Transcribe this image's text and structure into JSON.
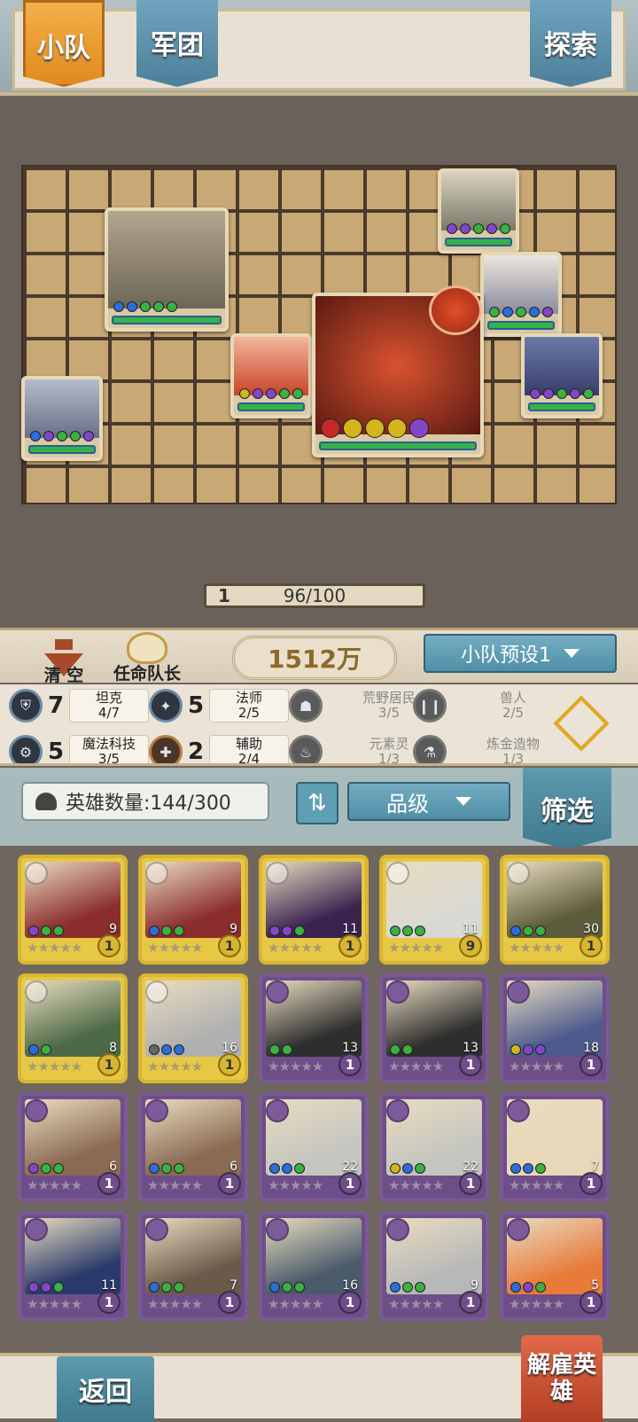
{
  "tabs": {
    "squad": "小队",
    "legion": "军团",
    "explore": "探索"
  },
  "squad": {
    "level": "1",
    "capacity": "96/100",
    "clear_label": "清 空",
    "captain_label": "任命队长",
    "power": "1512万",
    "preset": "小队预设1"
  },
  "synergies": [
    {
      "icon": "shield-icon",
      "count": "7",
      "name": "坦克",
      "progress": "4/7",
      "active": true
    },
    {
      "icon": "mage-icon",
      "count": "5",
      "name": "法师",
      "progress": "2/5",
      "active": true
    },
    {
      "icon": "wild-icon",
      "count": "",
      "name": "荒野居民",
      "progress": "3/5",
      "active": false
    },
    {
      "icon": "orc-icon",
      "count": "",
      "name": "兽人",
      "progress": "2/5",
      "active": false
    },
    {
      "icon": "tech-icon",
      "count": "5",
      "name": "魔法科技",
      "progress": "3/5",
      "active": true
    },
    {
      "icon": "support-icon",
      "count": "2",
      "name": "辅助",
      "progress": "2/4",
      "active": true
    },
    {
      "icon": "element-icon",
      "count": "",
      "name": "元素灵",
      "progress": "1/3",
      "active": false
    },
    {
      "icon": "alchemy-icon",
      "count": "",
      "name": "炼金造物",
      "progress": "1/3",
      "active": false
    }
  ],
  "filter": {
    "hero_count_label": "英雄数量:144/300",
    "sort_glyph": "⇅",
    "grade_label": "品级",
    "filter_label": "筛选"
  },
  "heroes": [
    {
      "count": "9",
      "level": "1",
      "tier": "gold",
      "dots": [
        "purple",
        "green",
        "green"
      ],
      "art": "#8b2d2d"
    },
    {
      "count": "9",
      "level": "1",
      "tier": "gold",
      "dots": [
        "blue",
        "green",
        "green"
      ],
      "art": "#8b2d2d"
    },
    {
      "count": "11",
      "level": "1",
      "tier": "gold",
      "dots": [
        "purple",
        "purple",
        "green"
      ],
      "art": "#3b2350"
    },
    {
      "count": "11",
      "level": "9",
      "tier": "gold",
      "dots": [
        "green",
        "green",
        "green"
      ],
      "art": "#d9d9d4"
    },
    {
      "count": "30",
      "level": "1",
      "tier": "gold",
      "dots": [
        "blue",
        "green",
        "green"
      ],
      "art": "#5d5c3a"
    },
    {
      "count": "8",
      "level": "1",
      "tier": "gold",
      "dots": [
        "blue",
        "green"
      ],
      "art": "#4d6a46"
    },
    {
      "count": "16",
      "level": "1",
      "tier": "gold",
      "dots": [
        "gray",
        "blue",
        "blue"
      ],
      "art": "#b0b0b0"
    },
    {
      "count": "13",
      "level": "1",
      "tier": "purple",
      "dots": [
        "green",
        "green"
      ],
      "art": "#2e2e2e"
    },
    {
      "count": "13",
      "level": "1",
      "tier": "purple",
      "dots": [
        "green",
        "green"
      ],
      "art": "#2e2e2e"
    },
    {
      "count": "18",
      "level": "1",
      "tier": "purple",
      "dots": [
        "yellow",
        "purple",
        "purple"
      ],
      "art": "#4c5a8c"
    },
    {
      "count": "6",
      "level": "1",
      "tier": "purple",
      "dots": [
        "purple",
        "green",
        "green"
      ],
      "art": "#8a6a52"
    },
    {
      "count": "6",
      "level": "1",
      "tier": "purple",
      "dots": [
        "blue",
        "green",
        "green"
      ],
      "art": "#8a6a52"
    },
    {
      "count": "22",
      "level": "1",
      "tier": "purple",
      "dots": [
        "blue",
        "blue",
        "green"
      ],
      "art": "#c5c5c0"
    },
    {
      "count": "22",
      "level": "1",
      "tier": "purple",
      "dots": [
        "yellow",
        "blue",
        "green"
      ],
      "art": "#c5c5c0"
    },
    {
      "count": "7",
      "level": "1",
      "tier": "purple",
      "dots": [
        "blue",
        "blue",
        "green"
      ],
      "art": "#e8d7b8"
    },
    {
      "count": "11",
      "level": "1",
      "tier": "purple",
      "dots": [
        "purple",
        "purple",
        "green"
      ],
      "art": "#2a3a6a"
    },
    {
      "count": "7",
      "level": "1",
      "tier": "purple",
      "dots": [
        "blue",
        "green",
        "green"
      ],
      "art": "#6a5a4a"
    },
    {
      "count": "16",
      "level": "1",
      "tier": "purple",
      "dots": [
        "blue",
        "green",
        "green"
      ],
      "art": "#4a5a6a"
    },
    {
      "count": "9",
      "level": "1",
      "tier": "purple",
      "dots": [
        "blue",
        "green",
        "green"
      ],
      "art": "#b8b8b8"
    },
    {
      "count": "5",
      "level": "1",
      "tier": "purple",
      "dots": [
        "blue",
        "purple",
        "green"
      ],
      "art": "#e87a3a"
    }
  ],
  "bottom": {
    "back_label": "返回",
    "dismiss_label": "解雇英雄"
  }
}
